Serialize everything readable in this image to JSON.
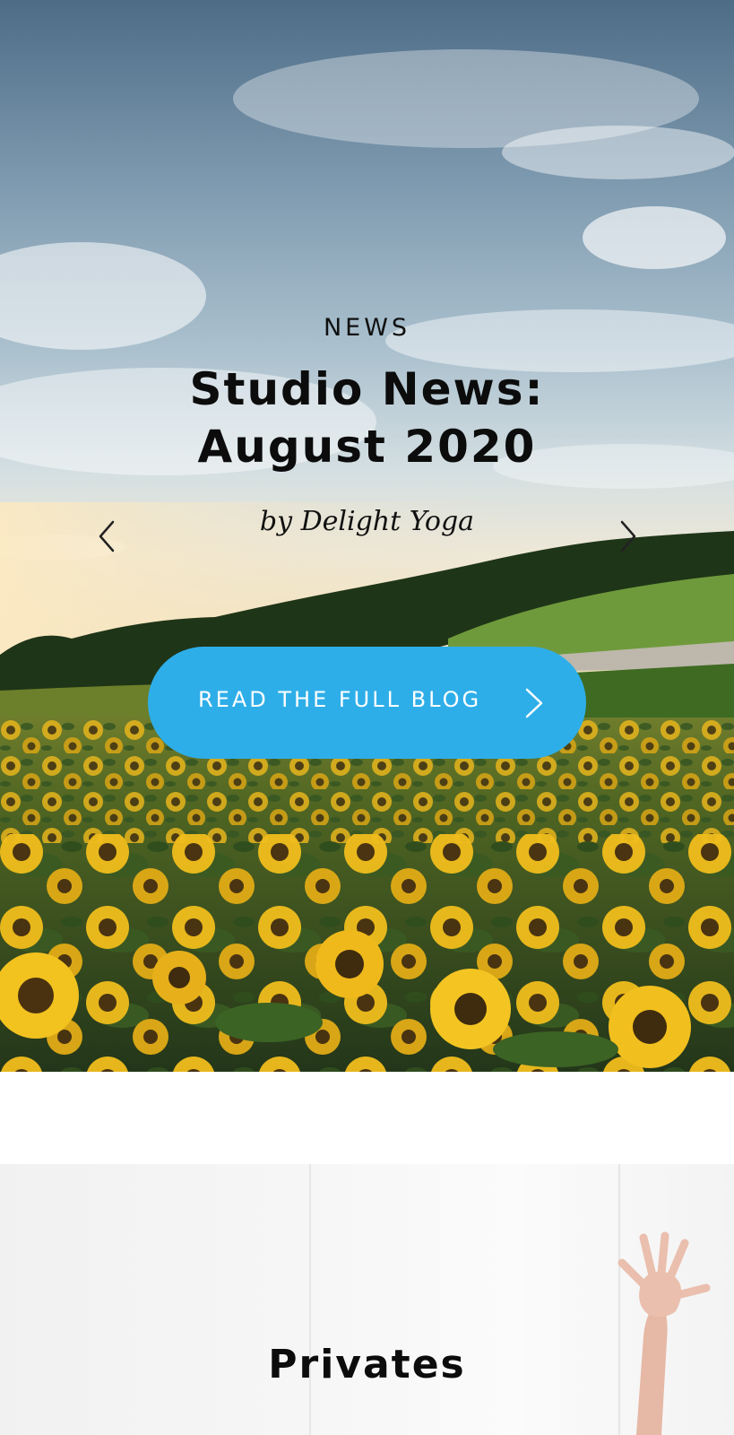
{
  "hero": {
    "category": "NEWS",
    "title_line1": "Studio News:",
    "title_line2": "August 2020",
    "author": "by Delight Yoga",
    "cta_label": "READ THE FULL BLOG",
    "prev_icon": "chevron-left-icon",
    "next_icon": "chevron-right-icon",
    "cta_icon": "chevron-right-icon",
    "accent_color": "#2eaee8"
  },
  "privates": {
    "title": "Privates"
  }
}
